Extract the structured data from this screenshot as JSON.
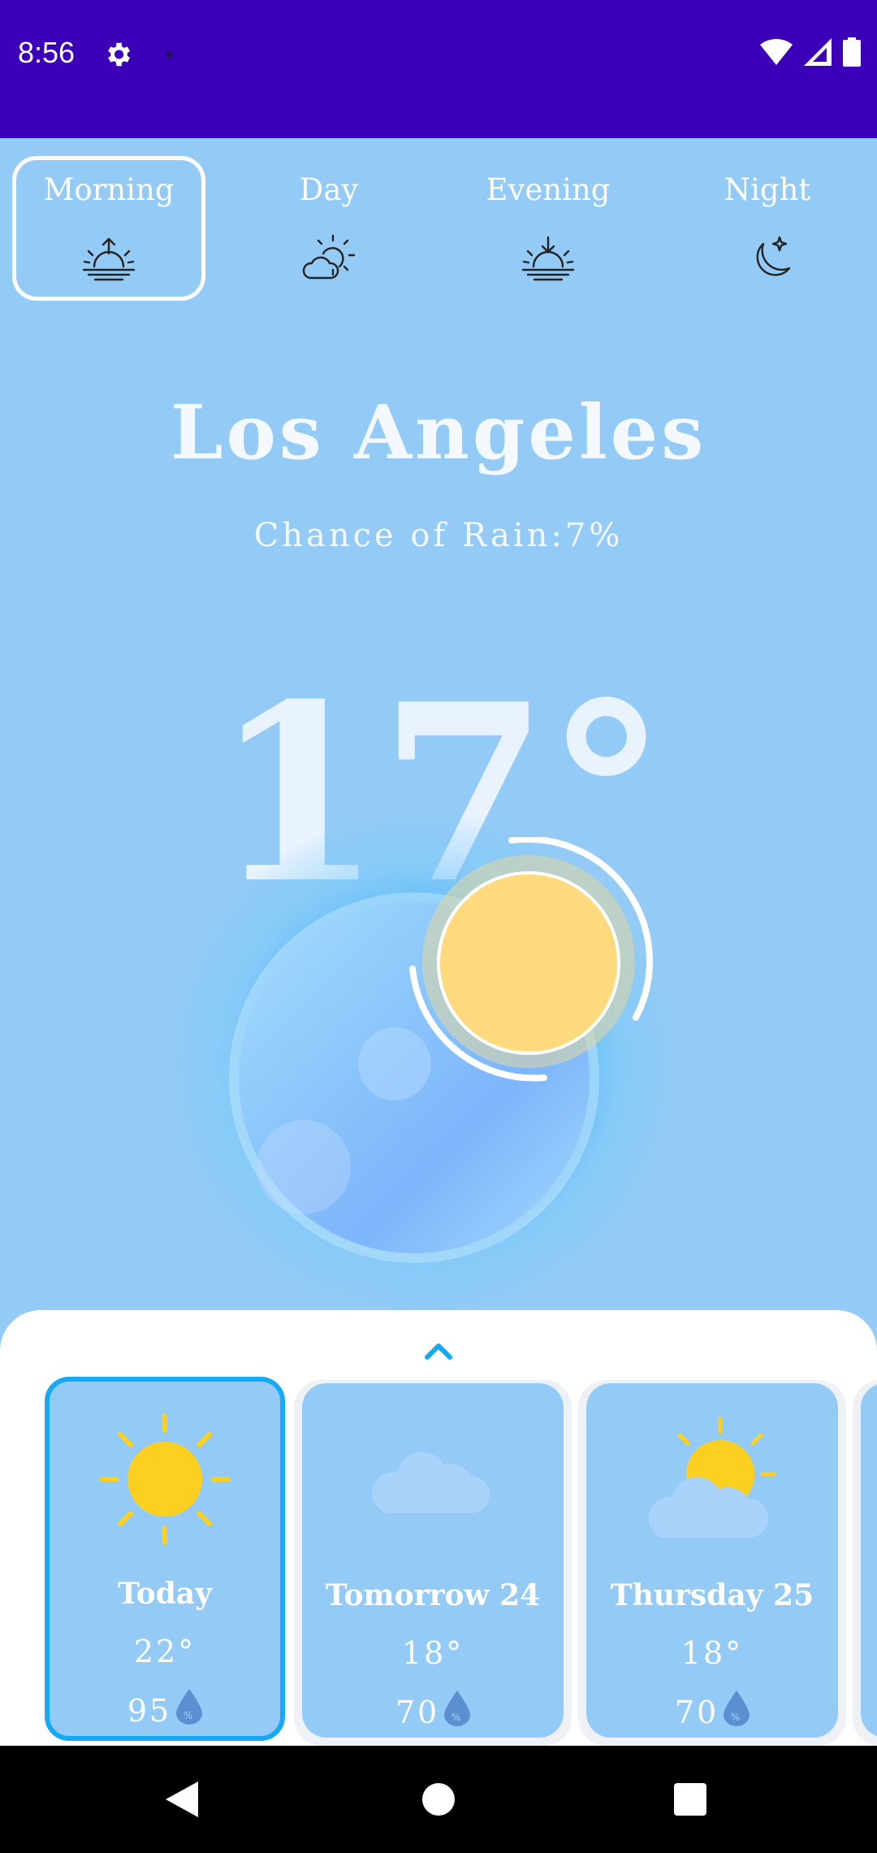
{
  "status_bar": {
    "time": "8:56",
    "icons": [
      "gear-icon",
      "wifi-icon",
      "signal-icon",
      "battery-icon"
    ],
    "background": "#3b00b7"
  },
  "tabs": [
    {
      "label": "Morning",
      "icon": "sunrise-icon",
      "active": true
    },
    {
      "label": "Day",
      "icon": "sun-cloud-icon",
      "active": false
    },
    {
      "label": "Evening",
      "icon": "sunset-icon",
      "active": false
    },
    {
      "label": "Night",
      "icon": "moon-star-icon",
      "active": false
    }
  ],
  "weather": {
    "city": "Los Angeles",
    "chance_of_rain": "Chance of Rain:7%",
    "temperature": "17°",
    "condition_icon": "sun-orb-icon"
  },
  "sheet": {
    "toggle_icon": "chevron-up-icon",
    "forecast": [
      {
        "day": "Today",
        "temp": "22°",
        "humidity": "95",
        "icon": "sun-icon",
        "selected": true
      },
      {
        "day": "Tomorrow 24",
        "temp": "18°",
        "humidity": "70",
        "icon": "cloud-icon",
        "selected": false
      },
      {
        "day": "Thursday 25",
        "temp": "18°",
        "humidity": "70",
        "icon": "partly-cloudy-icon",
        "selected": false
      }
    ]
  },
  "colors": {
    "background": "#93cbf6",
    "accent": "#17a9f5",
    "sun": "#ffd97d",
    "sun_icon": "#fcd021"
  },
  "nav_bar": {
    "icons": [
      "back-icon",
      "home-icon",
      "recents-icon"
    ]
  }
}
